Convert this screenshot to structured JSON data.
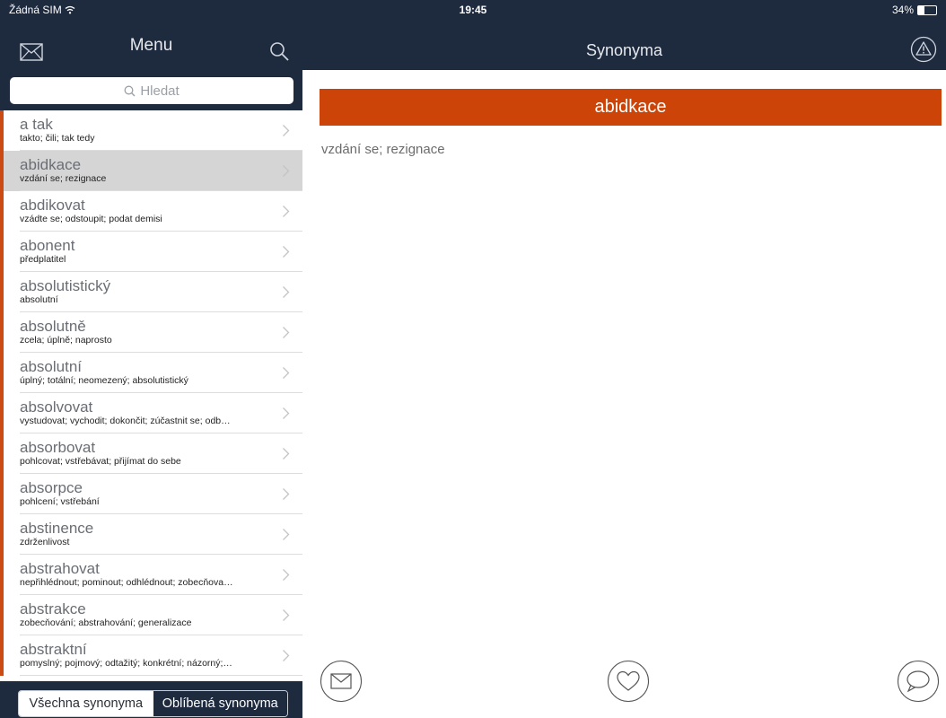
{
  "status": {
    "carrier": "Žádná SIM",
    "time": "19:45",
    "battery": "34%",
    "battery_level": 0.34
  },
  "sidebar": {
    "title": "Menu",
    "search_placeholder": "Hledat",
    "items": [
      {
        "word": "a tak",
        "synonyms": "takto; čili; tak tedy"
      },
      {
        "word": "abidkace",
        "synonyms": "vzdání se; rezignace",
        "selected": true
      },
      {
        "word": "abdikovat",
        "synonyms": "vzádte se; odstoupit; podat demisi"
      },
      {
        "word": "abonent",
        "synonyms": "předplatitel"
      },
      {
        "word": "absolutistický",
        "synonyms": "absolutní"
      },
      {
        "word": "absolutně",
        "synonyms": "zcela; úplně; naprosto"
      },
      {
        "word": "absolutní",
        "synonyms": "úplný; totální; neomezený; absolutistický"
      },
      {
        "word": "absolvovat",
        "synonyms": "vystudovat; vychodit; dokončit; zúčastnit se; odb…"
      },
      {
        "word": "absorbovat",
        "synonyms": "pohlcovat; vstřebávat; přijímat do sebe"
      },
      {
        "word": "absorpce",
        "synonyms": "pohlcení; vstřebání"
      },
      {
        "word": "abstinence",
        "synonyms": "zdrženlivost"
      },
      {
        "word": "abstrahovat",
        "synonyms": "nepřihlédnout; pominout; odhlédnout; zobecňova…"
      },
      {
        "word": "abstrakce",
        "synonyms": "zobecňování; abstrahování; generalizace"
      },
      {
        "word": "abstraktní",
        "synonyms": "pomyslný; pojmový; odtažitý; konkrétní; názorný;…"
      }
    ],
    "segments": {
      "all": "Všechna synonyma",
      "favorites": "Oblíbená synonyma"
    }
  },
  "main": {
    "title": "Synonyma",
    "selected_word": "abidkace",
    "selected_synonyms": "vzdání se; rezignace"
  },
  "colors": {
    "nav_bg": "#1e2a3e",
    "accent": "#cc4408",
    "selected_row": "#d5d5d5"
  }
}
